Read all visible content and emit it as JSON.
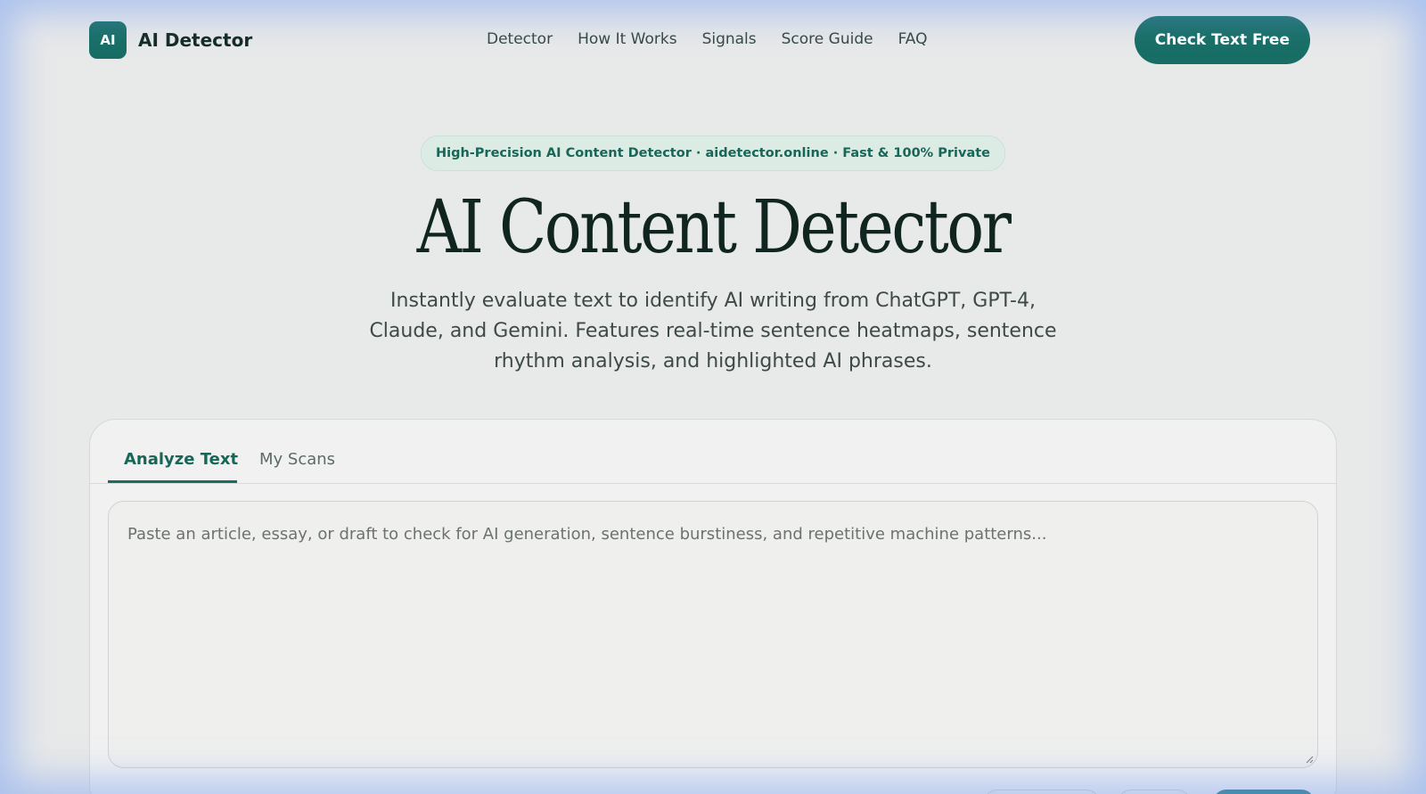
{
  "brand": {
    "logo_text": "AI",
    "name": "AI Detector"
  },
  "nav": {
    "links": [
      "Detector",
      "How It Works",
      "Signals",
      "Score Guide",
      "FAQ"
    ],
    "cta_label": "Check Text Free"
  },
  "hero": {
    "badge": "High-Precision AI Content Detector · aidetector.online · Fast & 100% Private",
    "title": "AI Content Detector",
    "subtitle": "Instantly evaluate text to identify AI writing from ChatGPT, GPT-4, Claude, and Gemini. Features real-time sentence heatmaps, sentence rhythm analysis, and highlighted AI phrases."
  },
  "panel": {
    "tabs": [
      {
        "label": "Analyze Text",
        "active": true
      },
      {
        "label": "My Scans",
        "active": false
      }
    ],
    "input": {
      "value": "",
      "placeholder": "Paste an article, essay, or draft to check for AI generation, sentence burstiness, and repetitive machine patterns..."
    }
  },
  "colors": {
    "accent": "#186e65",
    "background": "#e8e9e9",
    "badge_bg": "#dcebe4"
  }
}
